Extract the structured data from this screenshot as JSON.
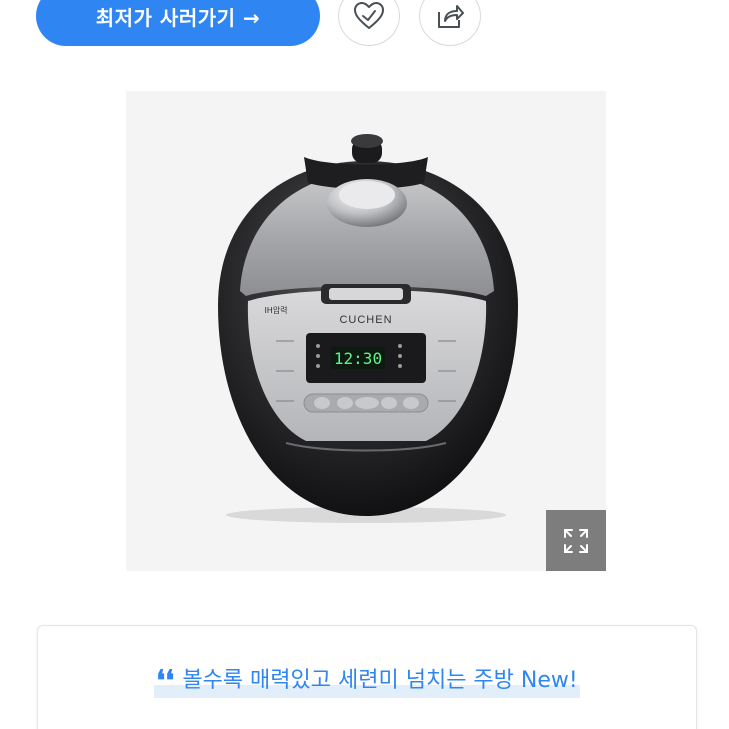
{
  "cta": {
    "label": "최저가 사러가기 →"
  },
  "actions": {
    "like_icon": "heart-check-icon",
    "share_icon": "share-icon"
  },
  "product": {
    "image_name": "rice-cooker-product-image",
    "brand": "CUCHEN",
    "display_time": "12:30",
    "badge": "IH압력"
  },
  "gallery": {
    "expand_icon": "expand-icon"
  },
  "quote": {
    "mark": "❛❛",
    "text": "볼수록 매력있고 세련미 넘치는 주방 New!"
  },
  "colors": {
    "accent": "#2f86f2",
    "card_border": "#e2e5ea",
    "expand_bg": "#7d7d7d"
  }
}
